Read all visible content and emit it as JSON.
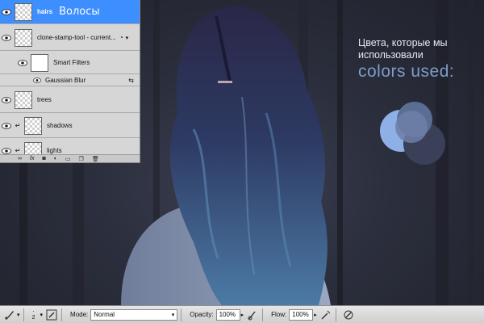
{
  "layers_panel": {
    "layers": [
      {
        "name": "hairs",
        "annotation": "Волосы",
        "selected": true
      },
      {
        "name": "clone-stamp-tool - current..."
      },
      {
        "name": "Smart Filters"
      },
      {
        "name": "Gaussian Blur"
      },
      {
        "name": "trees"
      },
      {
        "name": "shadows"
      },
      {
        "name": "lights"
      }
    ]
  },
  "annotation": {
    "title": "Цвета, которые мы использовали",
    "subtitle": "colors used:"
  },
  "swatches": [
    {
      "name": "light-blue",
      "color": "#8fb0e6"
    },
    {
      "name": "mid-blue",
      "color": "#5a6e93"
    },
    {
      "name": "slate-blue",
      "color": "#6f7fa8"
    },
    {
      "name": "dark-navy",
      "color": "#3a4058"
    }
  ],
  "options_bar": {
    "brush_size": "2",
    "mode_label": "Mode:",
    "mode_value": "Normal",
    "opacity_label": "Opacity:",
    "opacity_value": "100%",
    "flow_label": "Flow:",
    "flow_value": "100%"
  }
}
